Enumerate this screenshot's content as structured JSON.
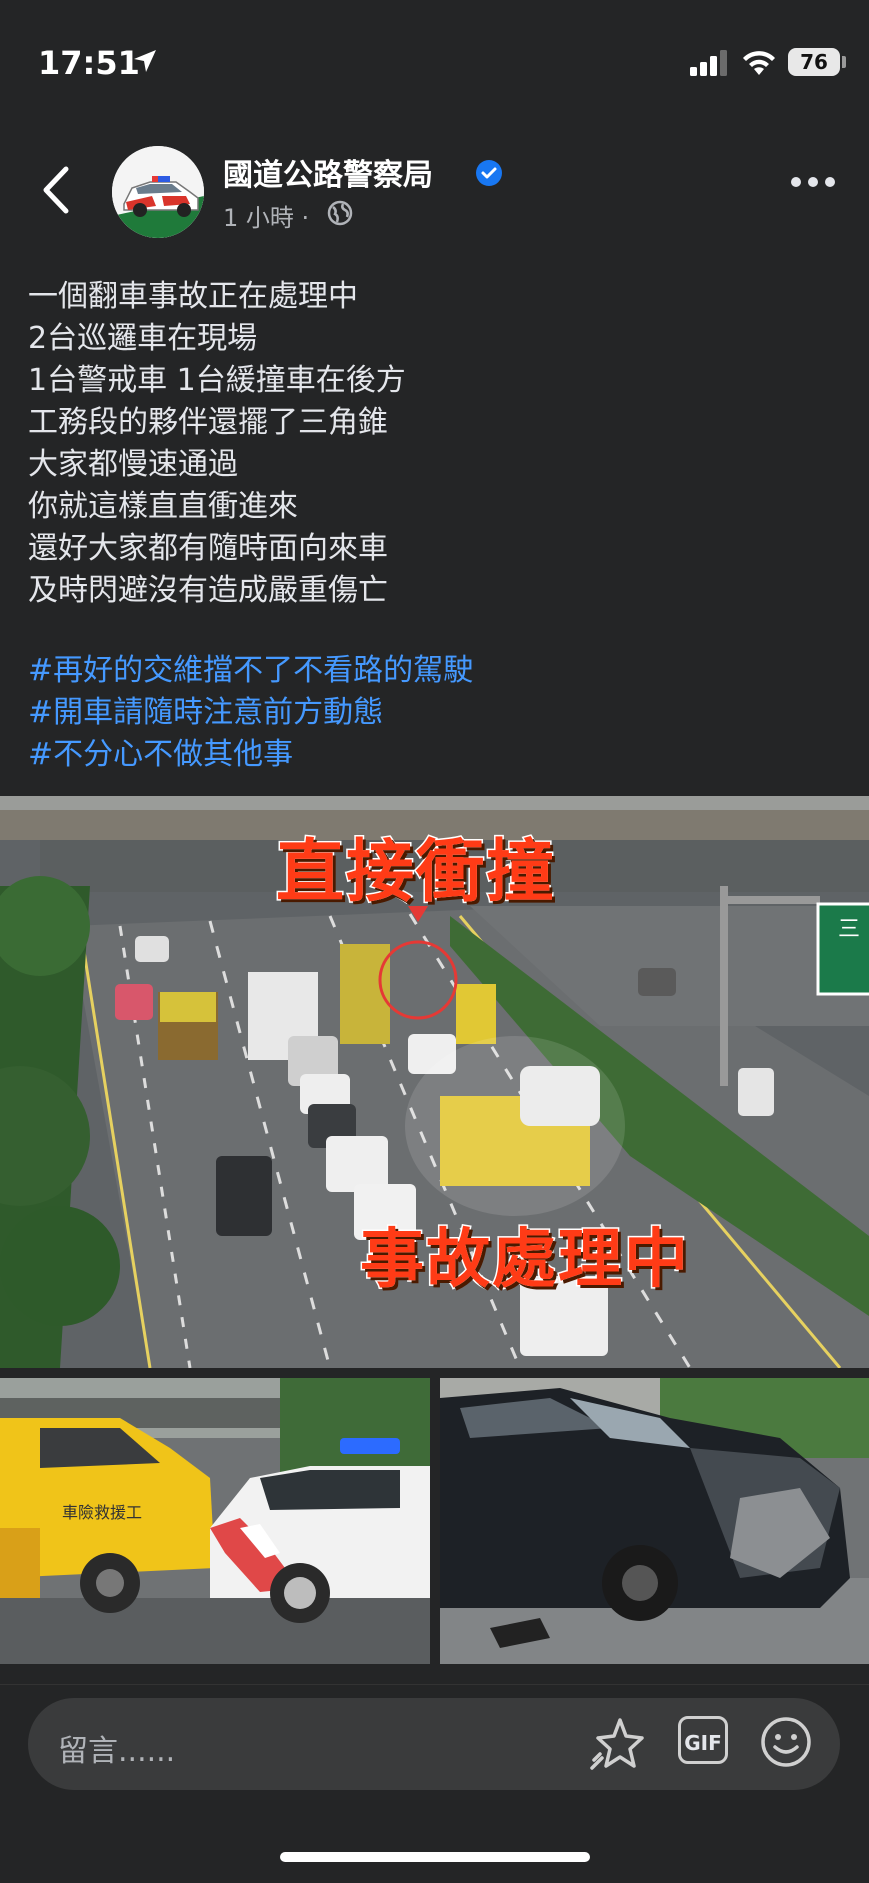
{
  "status_bar": {
    "time": "17:51",
    "battery": "76"
  },
  "header": {
    "page_name": "國道公路警察局",
    "time_ago": "1 小時",
    "separator": "·"
  },
  "post": {
    "lines": [
      "一個翻車事故正在處理中",
      "2台巡邏車在現場",
      "1台警戒車 1台緩撞車在後方",
      "工務段的夥伴還擺了三角錐",
      "大家都慢速通過",
      "你就這樣直直衝進來",
      "還好大家都有隨時面向來車",
      "及時閃避沒有造成嚴重傷亡"
    ],
    "hashtags": [
      "#再好的交維擋不了不看路的駕駛",
      "#開車請隨時注意前方動態",
      "#不分心不做其他事"
    ]
  },
  "images": {
    "main_caption_top": "直接衝撞",
    "main_caption_bottom": "事故處理中",
    "sign_text": "三",
    "tow_truck_text": "車險救援工"
  },
  "comment": {
    "placeholder": "留言......",
    "gif_label": "GIF"
  },
  "colors": {
    "background": "#242526",
    "hashtag": "#4599ff",
    "verified": "#1877f2",
    "overlay_red": "#ff3b16"
  }
}
